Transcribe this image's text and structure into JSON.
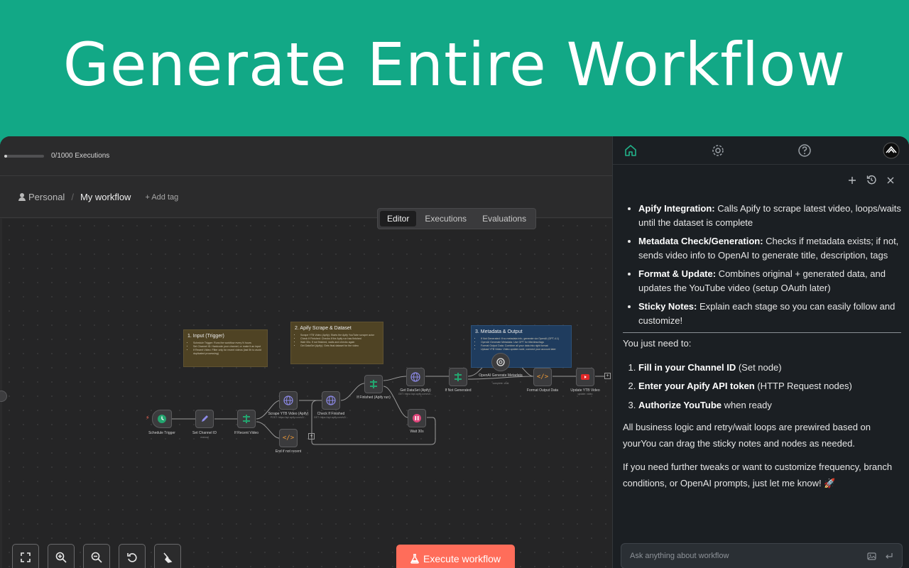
{
  "banner": {
    "title": "Generate Entire Workflow"
  },
  "execution_bar": {
    "text": "0/1000 Executions",
    "progress_fraction": 0
  },
  "breadcrumb": {
    "project": "Personal",
    "separator": "/",
    "workflow": "My workflow",
    "add_tag": "+ Add tag"
  },
  "tabs": [
    {
      "label": "Editor",
      "active": true
    },
    {
      "label": "Executions",
      "active": false
    },
    {
      "label": "Evaluations",
      "active": false
    }
  ],
  "sticky_notes": [
    {
      "title": "1. Input (Trigger)",
      "lines": [
        "Schedule Trigger: Runs the workflow every N hours",
        "Set Channel ID: Hardcode your channel, or make it an input",
        "If Recent Video: Filter only for recent videos (last 5h to avoid duplicated processing)"
      ]
    },
    {
      "title": "2. Apify Scrape & Dataset",
      "lines": [
        "Scrape YTB Video (Apify): Starts the Apify YouTube scraper actor",
        "Check If Finished: Checks if the Apify run has finished",
        "Wait 30s: If not finished, waits and checks again",
        "Get DataSet (Apify): Gets final dataset for the video"
      ]
    },
    {
      "title": "3. Metadata & Output",
      "lines": [
        "If Not Generated: If no metadata info, generate via OpenAI (GPT-4.1)",
        "OpenAI Generate Metadata: Use GPT for title/desc/tags",
        "Format Output Data: Combine all your data into right format",
        "Upload YTB Video: Video update node, connect your account later"
      ]
    }
  ],
  "nodes": {
    "schedule_trigger": {
      "label": "Schedule Trigger"
    },
    "set_channel_id": {
      "label": "Set Channel ID",
      "sub": "manual"
    },
    "if_recent_video": {
      "label": "If Recent Video"
    },
    "scrape_ytb": {
      "label": "Scrape YTB Video (Apify)",
      "sub": "POST: https://api.apify.com/v2/..."
    },
    "end_if_not_recent": {
      "label": "End if not recent"
    },
    "check_finished": {
      "label": "Check If Finished",
      "sub": "GET: https://api.apify.com/v2/..."
    },
    "if_finished": {
      "label": "If Finished (Apify run)"
    },
    "get_dataset": {
      "label": "Get DataSet (Apify)",
      "sub": "GET: https://api.apify.com/v2/..."
    },
    "wait_30s": {
      "label": "Wait 30s"
    },
    "if_not_generated": {
      "label": "If Not Generated"
    },
    "openai_generate": {
      "label": "OpenAI Generate Metadata",
      "sub": "complete: chat"
    },
    "format_output": {
      "label": "Format Output Data"
    },
    "update_ytb": {
      "label": "Update YTB Video",
      "sub": "update: video"
    }
  },
  "toolbar": {
    "execute_label": "Execute workflow"
  },
  "panel": {
    "bullets": [
      {
        "bold": "Apify Integration:",
        "text": " Calls Apify to scrape latest video, loops/waits until the dataset is complete"
      },
      {
        "bold": "Metadata Check/Generation:",
        "text": " Checks if metadata exists; if not, sends video info to OpenAI to generate title, description, tags"
      },
      {
        "bold": "Format & Update:",
        "text": " Combines original + generated data, and updates the YouTube video (setup OAuth later)"
      },
      {
        "bold": "Sticky Notes:",
        "text": " Explain each stage so you can easily follow and customize!"
      }
    ],
    "need_intro": "You just need to:",
    "steps": [
      {
        "bold": "Fill in your Channel ID",
        "text": " (Set node)"
      },
      {
        "bold": "Enter your Apify API token",
        "text": " (HTTP Request nodes)"
      },
      {
        "bold": "Authorize YouTube",
        "text": " when ready"
      }
    ],
    "para1": "All business logic and retry/wait loops are prewired based on yourYou can drag the sticky notes and nodes as needed.",
    "para2": "If you need further tweaks or want to customize frequency, branch conditions, or OpenAI prompts, just let me know! 🚀",
    "input_placeholder": "Ask anything about workflow"
  },
  "colors": {
    "banner": "#12a886",
    "execute": "#ff6d5a",
    "panel_bg": "#1b1f23"
  }
}
